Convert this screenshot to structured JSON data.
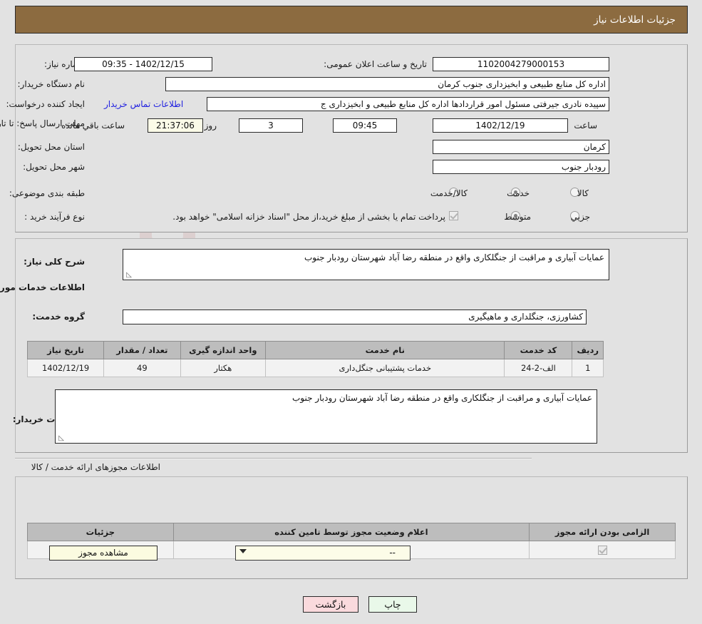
{
  "page": {
    "title": "جزئیات اطلاعات نیاز",
    "watermark": "AriaTender.net",
    "accent_color": "#8c6b40",
    "background_color": "#e2e2e2",
    "link_color": "#2121e0"
  },
  "need_info": {
    "need_number_label": "شماره نیاز:",
    "need_number_value": "1102004279000153",
    "announce_datetime_label": "تاریخ و ساعت اعلان عمومی:",
    "announce_datetime_value": "1402/12/15 - 09:35",
    "buyer_org_label": "نام دستگاه خریدار:",
    "buyer_org_value": "اداره کل منابع طبیعی و ابخیزداری جنوب کرمان",
    "creator_label": "ایجاد کننده درخواست:",
    "creator_value": "سپیده نادری جیرفتی مسئول امور قراردادها اداره کل منابع طبیعی و ابخیزداری ج",
    "buyer_contact_link": "اطلاعات تماس خریدار",
    "deadline_label": "مهلت ارسال پاسخ: تا تاریخ:",
    "deadline_date": "1402/12/19",
    "deadline_hour_label": "ساعت",
    "deadline_hour": "09:45",
    "remaining_days": "3",
    "remaining_days_label": "روز و",
    "remaining_time": "21:37:06",
    "remaining_time_label": "ساعت باقي مانده",
    "province_label": "استان محل تحویل:",
    "province_value": "کرمان",
    "city_label": "شهر محل تحویل:",
    "city_value": "رودبار جنوب",
    "category_label": "طبقه بندی موضوعی:",
    "category_options": [
      "کالا",
      "خدمت",
      "کالا/خدمت"
    ],
    "category_selected": "خدمت",
    "process_label": "نوع فرآیند خرید :",
    "process_options": [
      "جزيي",
      "متوسط"
    ],
    "process_selected": "متوسط",
    "treasury_note": "پرداخت تمام یا بخشی از مبلغ خرید،از محل \"اسناد خزانه اسلامی\" خواهد بود.",
    "treasury_checked": true
  },
  "need_description": {
    "label": "شرح کلی نیاز:",
    "value": "عمایات آبیاری و مراقبت از جنگلکاری واقع در منطقه رضا آباد شهرستان رودبار جنوب"
  },
  "services": {
    "section_title": "اطلاعات خدمات مورد نیاز",
    "group_label": "گروه خدمت:",
    "group_value": "کشاورزی، جنگلداری و ماهیگیری",
    "columns": [
      "ردیف",
      "کد خدمت",
      "نام خدمت",
      "واحد اندازه گیری",
      "تعداد / مقدار",
      "تاریخ نیاز"
    ],
    "rows": [
      {
        "row": "1",
        "code": "الف-2-24",
        "name": "خدمات پشتیبانی جنگل‌داری",
        "unit": "هکتار",
        "quantity": "49",
        "date": "1402/12/19"
      }
    ]
  },
  "buyer_notes": {
    "label": "توضیحات خریدار:",
    "value": "عمایات آبیاری و مراقبت از جنگلکاری واقع در منطقه رضا آباد شهرستان رودبار جنوب"
  },
  "permits": {
    "section_title": "اطلاعات مجوزهای ارائه خدمت / کالا",
    "columns": [
      "الزامی بودن ارائه مجوز",
      "اعلام وضعیت مجوز توسط تامین کننده",
      "جزئیات"
    ],
    "rows": [
      {
        "required_checked": true,
        "status_value": "--",
        "details_button": "مشاهده مجوز"
      }
    ]
  },
  "footer": {
    "print_label": "چاپ",
    "back_label": "بازگشت"
  }
}
